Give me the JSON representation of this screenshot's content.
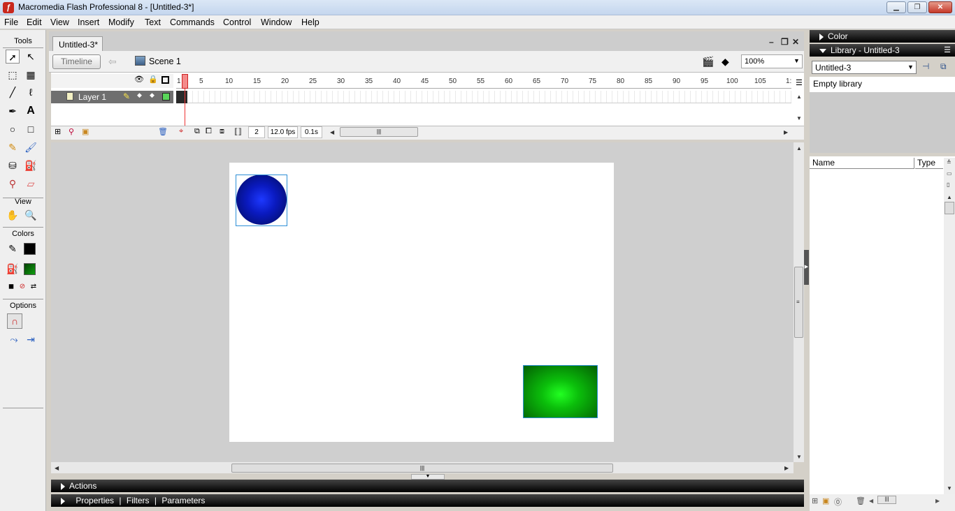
{
  "window": {
    "title": "Macromedia Flash Professional 8 - [Untitled-3*]",
    "app_icon": "flash-f-icon",
    "min_label": "▁",
    "max_label": "❐",
    "close_label": "✕"
  },
  "menu": [
    "File",
    "Edit",
    "View",
    "Insert",
    "Modify",
    "Text",
    "Commands",
    "Control",
    "Window",
    "Help"
  ],
  "tools_panel": {
    "tools_heading": "Tools",
    "view_heading": "View",
    "colors_heading": "Colors",
    "options_heading": "Options",
    "stroke_color": "#000000",
    "fill_color": "#10a010"
  },
  "document": {
    "tab_label": "Untitled-3*",
    "timeline_button": "Timeline",
    "scene_label": "Scene 1",
    "zoom": "100%"
  },
  "timeline": {
    "ruler_numbers": [
      "1",
      "5",
      "10",
      "15",
      "20",
      "25",
      "30",
      "35",
      "40",
      "45",
      "50",
      "55",
      "60",
      "65",
      "70",
      "75",
      "80",
      "85",
      "90",
      "95",
      "100",
      "105",
      "1:"
    ],
    "layer_name": "Layer 1",
    "current_frame": "2",
    "frame_rate": "12.0 fps",
    "elapsed_time": "0.1s"
  },
  "stage": {
    "shapes": [
      {
        "name": "blue circle",
        "colors": [
          "#1e39ff",
          "#010a55"
        ]
      },
      {
        "name": "green rectangle",
        "colors": [
          "#22ff22",
          "#035f03"
        ]
      }
    ]
  },
  "bottom_panels": {
    "actions_label": "Actions",
    "properties_label": "Properties",
    "filters_label": "Filters",
    "parameters_label": "Parameters",
    "separator": "|"
  },
  "right_panel": {
    "color_label": "Color",
    "library_label": "Library - Untitled-3",
    "library_select": "Untitled-3",
    "empty_label": "Empty library",
    "col_name": "Name",
    "col_type": "Type"
  }
}
